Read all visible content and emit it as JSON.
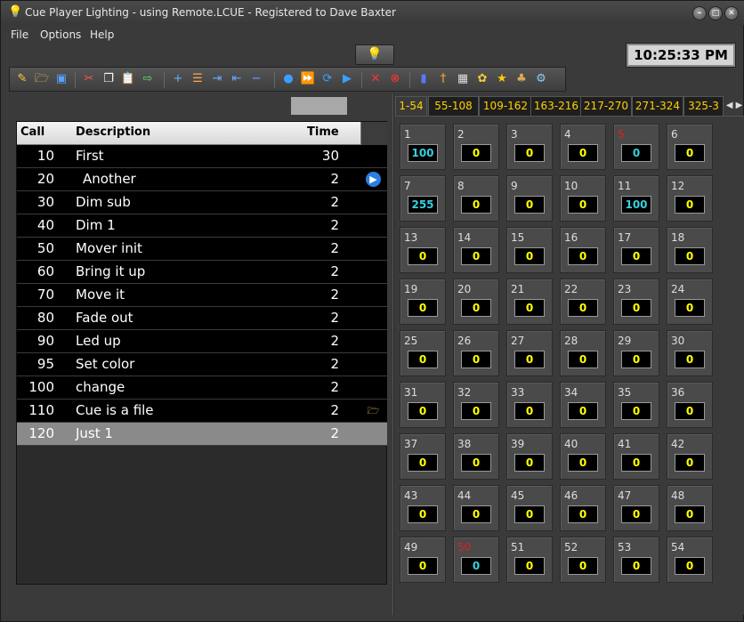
{
  "window": {
    "title": "Cue Player Lighting - using Remote.LCUE - Registered to Dave Baxter"
  },
  "menu": [
    "File",
    "Options",
    "Help"
  ],
  "clock": "10:25:33 PM",
  "toolbar_icons": [
    "wand-icon",
    "open-icon",
    "save-icon",
    "cut-icon",
    "copy-icon",
    "paste-icon",
    "export-icon",
    "add-icon",
    "insert-icon",
    "indent-icon",
    "outdent-icon",
    "remove-icon",
    "record-icon",
    "forward-icon",
    "refresh-icon",
    "play-icon",
    "stop-icon",
    "cancel-icon",
    "channel-icon",
    "fader-icon",
    "scene-icon",
    "effects-icon",
    "star-icon",
    "group-icon",
    "settings-icon"
  ],
  "grid": {
    "headers": {
      "call": "Call",
      "description": "Description",
      "time": "Time"
    },
    "rows": [
      {
        "call": "10",
        "desc": "First",
        "time": "30",
        "icon": ""
      },
      {
        "call": "20",
        "desc": "Another",
        "time": "2",
        "icon": "play"
      },
      {
        "call": "30",
        "desc": "Dim sub",
        "time": "2",
        "icon": ""
      },
      {
        "call": "40",
        "desc": "Dim 1",
        "time": "2",
        "icon": ""
      },
      {
        "call": "50",
        "desc": "Mover init",
        "time": "2",
        "icon": ""
      },
      {
        "call": "60",
        "desc": "Bring it up",
        "time": "2",
        "icon": ""
      },
      {
        "call": "70",
        "desc": "Move it",
        "time": "2",
        "icon": ""
      },
      {
        "call": "80",
        "desc": "Fade out",
        "time": "2",
        "icon": ""
      },
      {
        "call": "90",
        "desc": "Led up",
        "time": "2",
        "icon": ""
      },
      {
        "call": "95",
        "desc": "Set color",
        "time": "2",
        "icon": ""
      },
      {
        "call": "100",
        "desc": "change",
        "time": "2",
        "icon": ""
      },
      {
        "call": "110",
        "desc": "Cue is a file",
        "time": "2",
        "icon": "file"
      },
      {
        "call": "120",
        "desc": "Just 1",
        "time": "2",
        "icon": "",
        "selected": true
      }
    ]
  },
  "tabs": [
    "1-54",
    "55-108",
    "109-162",
    "163-216",
    "217-270",
    "271-324",
    "325-3"
  ],
  "channels": [
    {
      "n": "1",
      "v": "100",
      "c": true
    },
    {
      "n": "2",
      "v": "0"
    },
    {
      "n": "3",
      "v": "0"
    },
    {
      "n": "4",
      "v": "0"
    },
    {
      "n": "5",
      "v": "0",
      "c": true,
      "r": true
    },
    {
      "n": "6",
      "v": "0"
    },
    {
      "n": "7",
      "v": "255",
      "c": true
    },
    {
      "n": "8",
      "v": "0"
    },
    {
      "n": "9",
      "v": "0"
    },
    {
      "n": "10",
      "v": "0"
    },
    {
      "n": "11",
      "v": "100",
      "c": true
    },
    {
      "n": "12",
      "v": "0"
    },
    {
      "n": "13",
      "v": "0"
    },
    {
      "n": "14",
      "v": "0"
    },
    {
      "n": "15",
      "v": "0"
    },
    {
      "n": "16",
      "v": "0"
    },
    {
      "n": "17",
      "v": "0"
    },
    {
      "n": "18",
      "v": "0"
    },
    {
      "n": "19",
      "v": "0"
    },
    {
      "n": "20",
      "v": "0"
    },
    {
      "n": "21",
      "v": "0"
    },
    {
      "n": "22",
      "v": "0"
    },
    {
      "n": "23",
      "v": "0"
    },
    {
      "n": "24",
      "v": "0"
    },
    {
      "n": "25",
      "v": "0"
    },
    {
      "n": "26",
      "v": "0"
    },
    {
      "n": "27",
      "v": "0"
    },
    {
      "n": "28",
      "v": "0"
    },
    {
      "n": "29",
      "v": "0"
    },
    {
      "n": "30",
      "v": "0"
    },
    {
      "n": "31",
      "v": "0"
    },
    {
      "n": "32",
      "v": "0"
    },
    {
      "n": "33",
      "v": "0"
    },
    {
      "n": "34",
      "v": "0"
    },
    {
      "n": "35",
      "v": "0"
    },
    {
      "n": "36",
      "v": "0"
    },
    {
      "n": "37",
      "v": "0"
    },
    {
      "n": "38",
      "v": "0"
    },
    {
      "n": "39",
      "v": "0"
    },
    {
      "n": "40",
      "v": "0"
    },
    {
      "n": "41",
      "v": "0"
    },
    {
      "n": "42",
      "v": "0"
    },
    {
      "n": "43",
      "v": "0"
    },
    {
      "n": "44",
      "v": "0"
    },
    {
      "n": "45",
      "v": "0"
    },
    {
      "n": "46",
      "v": "0"
    },
    {
      "n": "47",
      "v": "0"
    },
    {
      "n": "48",
      "v": "0"
    },
    {
      "n": "49",
      "v": "0"
    },
    {
      "n": "50",
      "v": "0",
      "c": true,
      "r": true
    },
    {
      "n": "51",
      "v": "0"
    },
    {
      "n": "52",
      "v": "0"
    },
    {
      "n": "53",
      "v": "0"
    },
    {
      "n": "54",
      "v": "0"
    }
  ]
}
